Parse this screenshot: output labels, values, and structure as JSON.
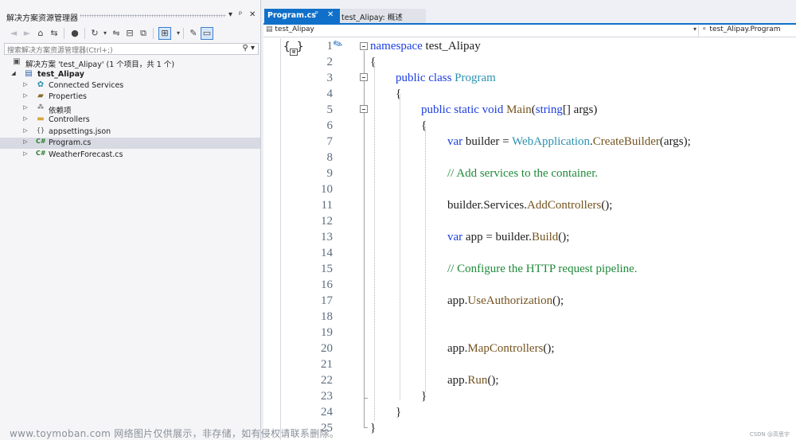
{
  "solution_explorer": {
    "title": "解决方案资源管理器",
    "pin_glyph": "▾ ᵖ ✕",
    "search_placeholder": "搜索解决方案资源管理器(Ctrl+;)",
    "tree": [
      {
        "label": "解决方案 'test_Alipay' (1 个项目，共 1 个)",
        "icon": "solution-icon"
      },
      {
        "label": "test_Alipay",
        "icon": "csproj-icon",
        "bold": true
      },
      {
        "label": "Connected Services",
        "icon": "connected-services-icon"
      },
      {
        "label": "Properties",
        "icon": "wrench-folder-icon"
      },
      {
        "label": "依赖项",
        "icon": "dependencies-icon"
      },
      {
        "label": "Controllers",
        "icon": "folder-icon"
      },
      {
        "label": "appsettings.json",
        "icon": "json-file-icon"
      },
      {
        "label": "Program.cs",
        "icon": "csharp-file-icon",
        "selected": true
      },
      {
        "label": "WeatherForecast.cs",
        "icon": "csharp-file-icon"
      }
    ]
  },
  "editor": {
    "tabs": [
      {
        "label": "Program.cs",
        "active": true
      },
      {
        "label": "test_Alipay: 概述",
        "active": false
      }
    ],
    "nav_left": "test_Alipay",
    "nav_right": "test_Alipay.Program",
    "line_numbers": [
      "1",
      "2",
      "3",
      "4",
      "5",
      "6",
      "7",
      "8",
      "9",
      "10",
      "11",
      "12",
      "13",
      "14",
      "15",
      "16",
      "17",
      "18",
      "19",
      "20",
      "21",
      "22",
      "23",
      "24",
      "25"
    ],
    "code": {
      "l1_kw": "namespace",
      "l1_rest": " test_Alipay",
      "l2": "{",
      "l3_kw1": "public",
      "l3_kw2": "class",
      "l3_ty": "Program",
      "l4": "{",
      "l5_kw": "public static void",
      "l5_mt": "Main",
      "l5_p1": "(",
      "l5_kw2": "string",
      "l5_p2": "[] args)",
      "l6": "{",
      "l7_kw": "var",
      "l7_a": " builder = ",
      "l7_ty": "WebApplication",
      "l7_dot": ".",
      "l7_mt": "CreateBuilder",
      "l7_b": "(args);",
      "l9": "// Add services to the container.",
      "l11_a": "builder.Services.",
      "l11_mt": "AddControllers",
      "l11_b": "();",
      "l13_kw": "var",
      "l13_a": " app = builder.",
      "l13_mt": "Build",
      "l13_b": "();",
      "l15": "// Configure the HTTP request pipeline.",
      "l17_a": "app.",
      "l17_mt": "UseAuthorization",
      "l17_b": "();",
      "l20_a": "app.",
      "l20_mt": "MapControllers",
      "l20_b": "();",
      "l22_a": "app.",
      "l22_mt": "Run",
      "l22_b": "();",
      "l23": "}",
      "l24": "}",
      "l25": "}"
    }
  },
  "watermark": "www.toymoban.com 网络图片仅供展示，非存储，如有侵权请联系删除。",
  "csdn_mark": "CSDN @高思宇",
  "colors": {
    "accent": "#1070c9",
    "keyword": "#1b3ee0",
    "type": "#2b91af",
    "method": "#74531f",
    "comment": "#1f8a3a"
  }
}
